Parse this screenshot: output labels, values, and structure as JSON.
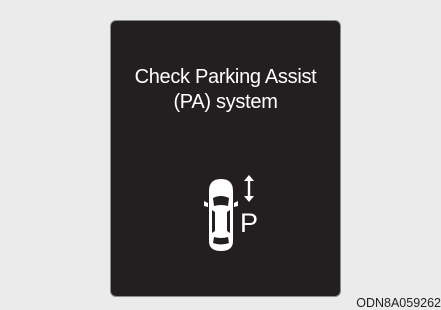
{
  "display": {
    "message_line1": "Check Parking Assist",
    "message_line2": "(PA) system",
    "icon": "parking-assist-warning-icon",
    "icon_letter": "P",
    "background_color": "#231f20",
    "text_color": "#ffffff"
  },
  "reference_code": "ODN8A059262"
}
